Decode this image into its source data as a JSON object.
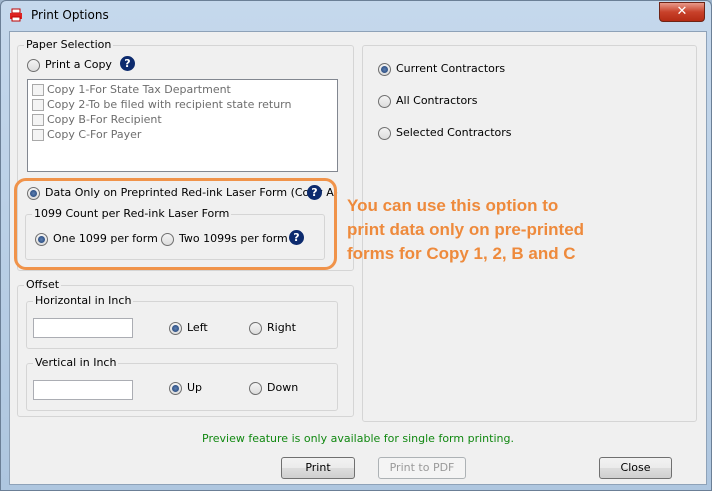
{
  "window": {
    "title": "Print Options",
    "close_glyph": "✕"
  },
  "paper_selection": {
    "title": "Paper Selection",
    "print_copy_label": "Print a Copy",
    "copies": [
      "Copy 1-For State Tax Department",
      "Copy 2-To be filed with recipient state return",
      "Copy B-For Recipient",
      "Copy C-For Payer"
    ],
    "data_only_label": "Data Only on Preprinted Red-ink Laser Form (Copy A)",
    "count_group_title": "1099 Count per Red-ink Laser Form",
    "one_label": "One 1099 per form",
    "two_label": "Two 1099s per form",
    "help_glyph": "?"
  },
  "offset": {
    "title": "Offset",
    "horizontal": {
      "title": "Horizontal in Inch",
      "value": "",
      "left_label": "Left",
      "right_label": "Right"
    },
    "vertical": {
      "title": "Vertical in Inch",
      "value": "",
      "up_label": "Up",
      "down_label": "Down"
    }
  },
  "contractors": {
    "options": [
      "Current Contractors",
      "All Contractors",
      "Selected Contractors"
    ],
    "selected": "Current Contractors"
  },
  "callout_text": "You can use this option to print data only on pre-printed forms for Copy 1, 2, B and C",
  "preview_note": "Preview feature is only available for single form printing.",
  "buttons": {
    "print": "Print",
    "print_pdf": "Print to PDF",
    "close": "Close"
  },
  "colors": {
    "callout": "#ee8a3c",
    "note": "#118811",
    "help": "#0d2b6e"
  }
}
